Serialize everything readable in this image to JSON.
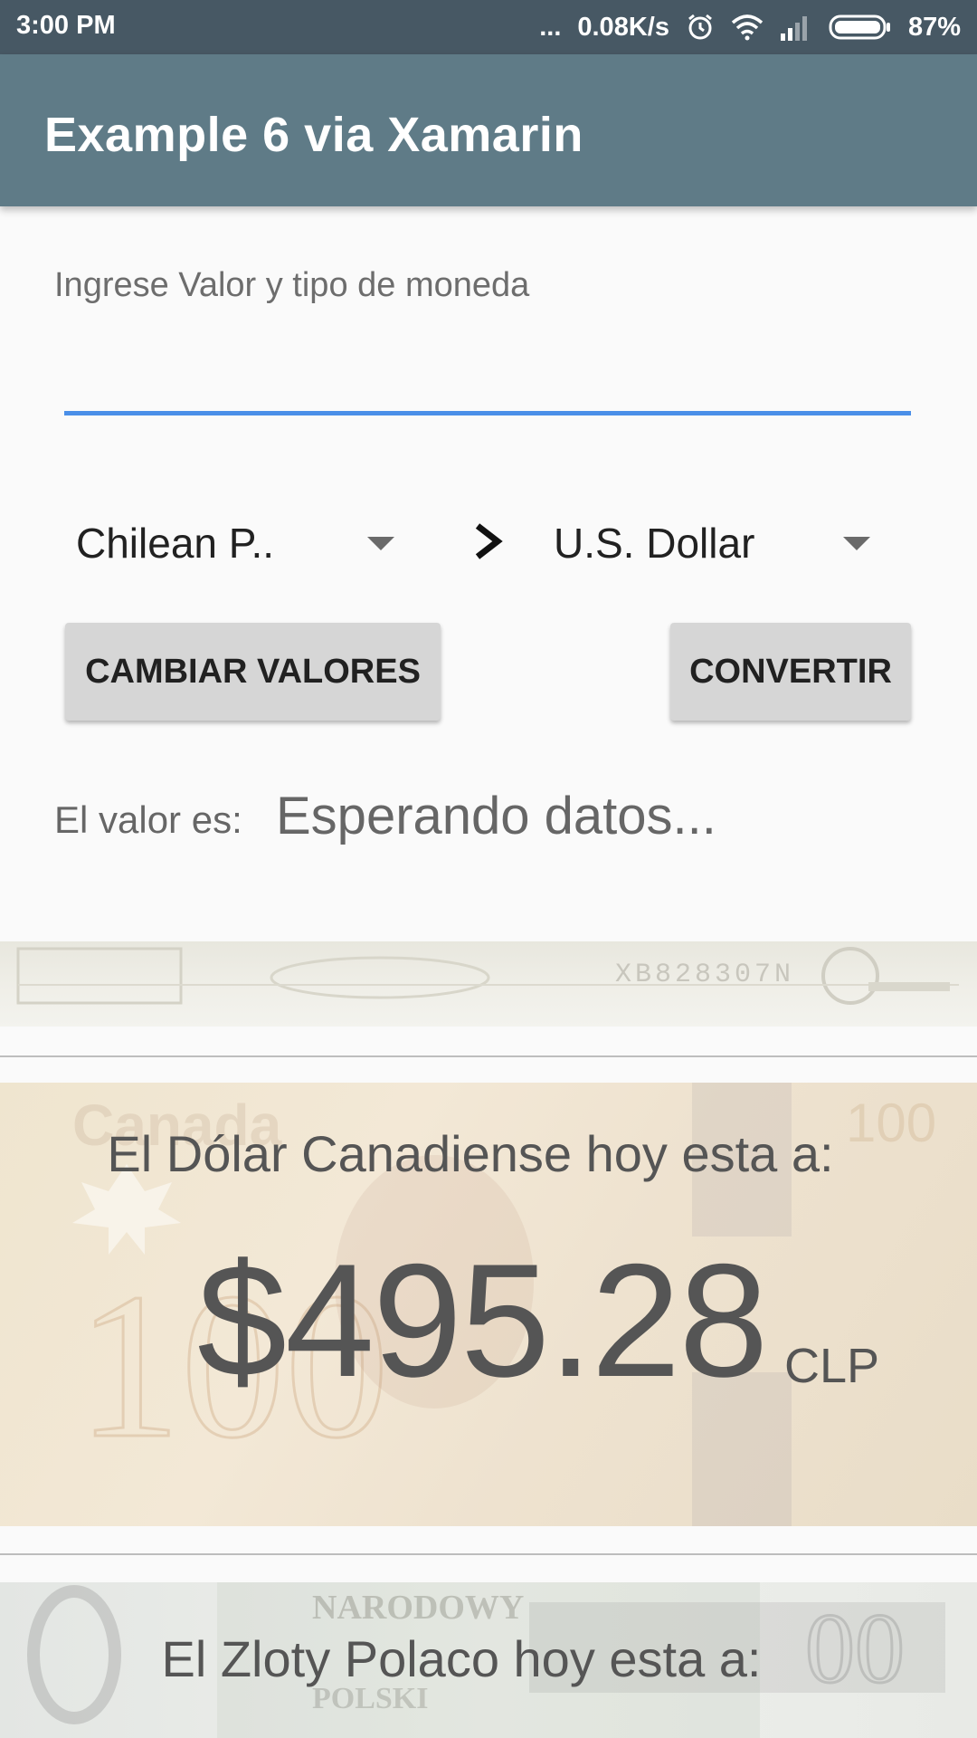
{
  "status_bar": {
    "time": "3:00 PM",
    "dots": "...",
    "network_speed": "0.08K/s",
    "battery": "87%",
    "icons": [
      "alarm-icon",
      "wifi-icon",
      "signal-icon",
      "battery-icon"
    ]
  },
  "app_bar": {
    "title": "Example 6 via Xamarin",
    "color": "#5f7b87"
  },
  "form": {
    "prompt": "Ingrese Valor y tipo de moneda",
    "value_input": {
      "value": "",
      "placeholder": ""
    },
    "from_currency": "Chilean P..",
    "to_currency": "U.S. Dollar",
    "swap_button": "CAMBIAR VALORES",
    "convert_button": "CONVERTIR",
    "result_label": "El valor es:",
    "result_value": "Esperando datos..."
  },
  "cards": [
    {
      "note_serial": "XB828307N"
    },
    {
      "title": "El Dólar Canadiense hoy esta a:",
      "rate": "$495.28",
      "unit": "CLP",
      "watermark": "Canada"
    },
    {
      "title": "El Zloty Polaco hoy esta a:",
      "watermark_top": "NARODOWY",
      "watermark_bottom": "POLSKI"
    }
  ],
  "accent_color": "#4a8fe8"
}
